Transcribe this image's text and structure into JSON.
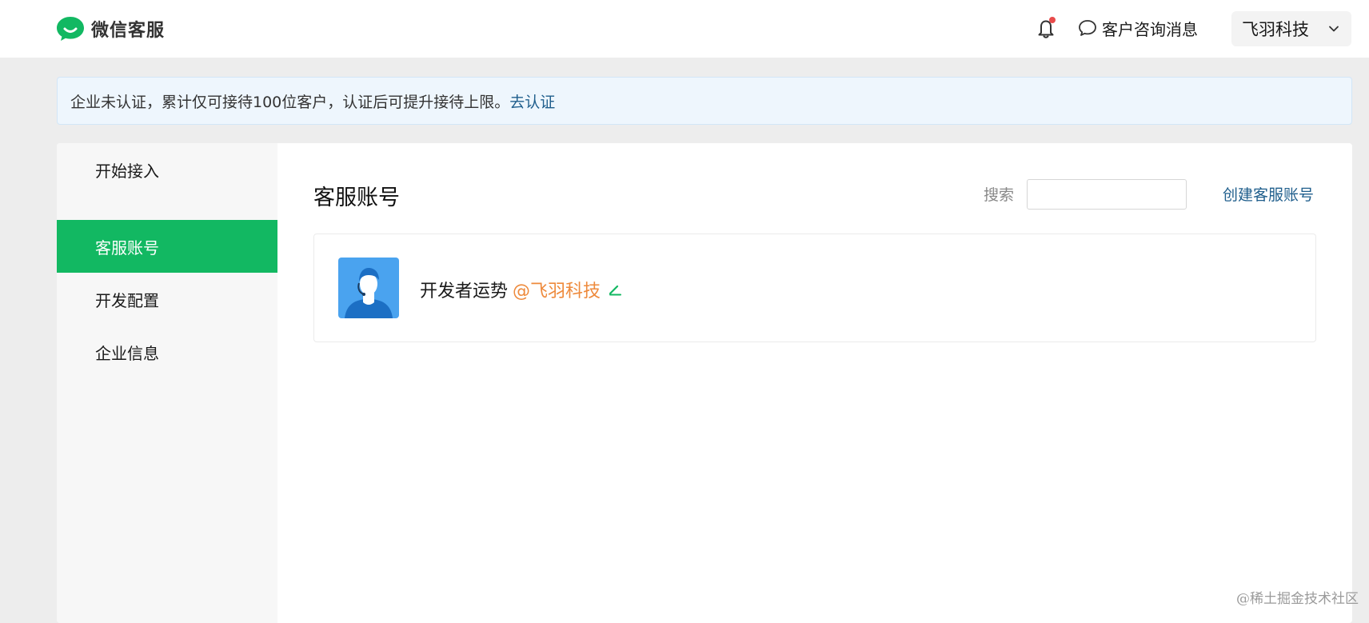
{
  "header": {
    "brand_name": "微信客服",
    "consult_label": "客户咨询消息",
    "account_name": "飞羽科技"
  },
  "notice": {
    "text": "企业未认证，累计仅可接待100位客户，认证后可提升接待上限。",
    "link": "去认证"
  },
  "sidebar": {
    "items": [
      {
        "label": "开始接入",
        "active": false
      },
      {
        "label": "客服账号",
        "active": true
      },
      {
        "label": "开发配置",
        "active": false
      },
      {
        "label": "企业信息",
        "active": false
      }
    ]
  },
  "main": {
    "title": "客服账号",
    "search_label": "搜索",
    "search_value": "",
    "create_label": "创建客服账号",
    "accounts": [
      {
        "name": "开发者运势",
        "org": "@飞羽科技"
      }
    ]
  },
  "watermark": "@稀土掘金技术社区",
  "colors": {
    "accent_green": "#12b862",
    "org_orange": "#ee8a3c",
    "link_blue": "#1f5e8c",
    "notification_dot": "#e84b4b"
  }
}
